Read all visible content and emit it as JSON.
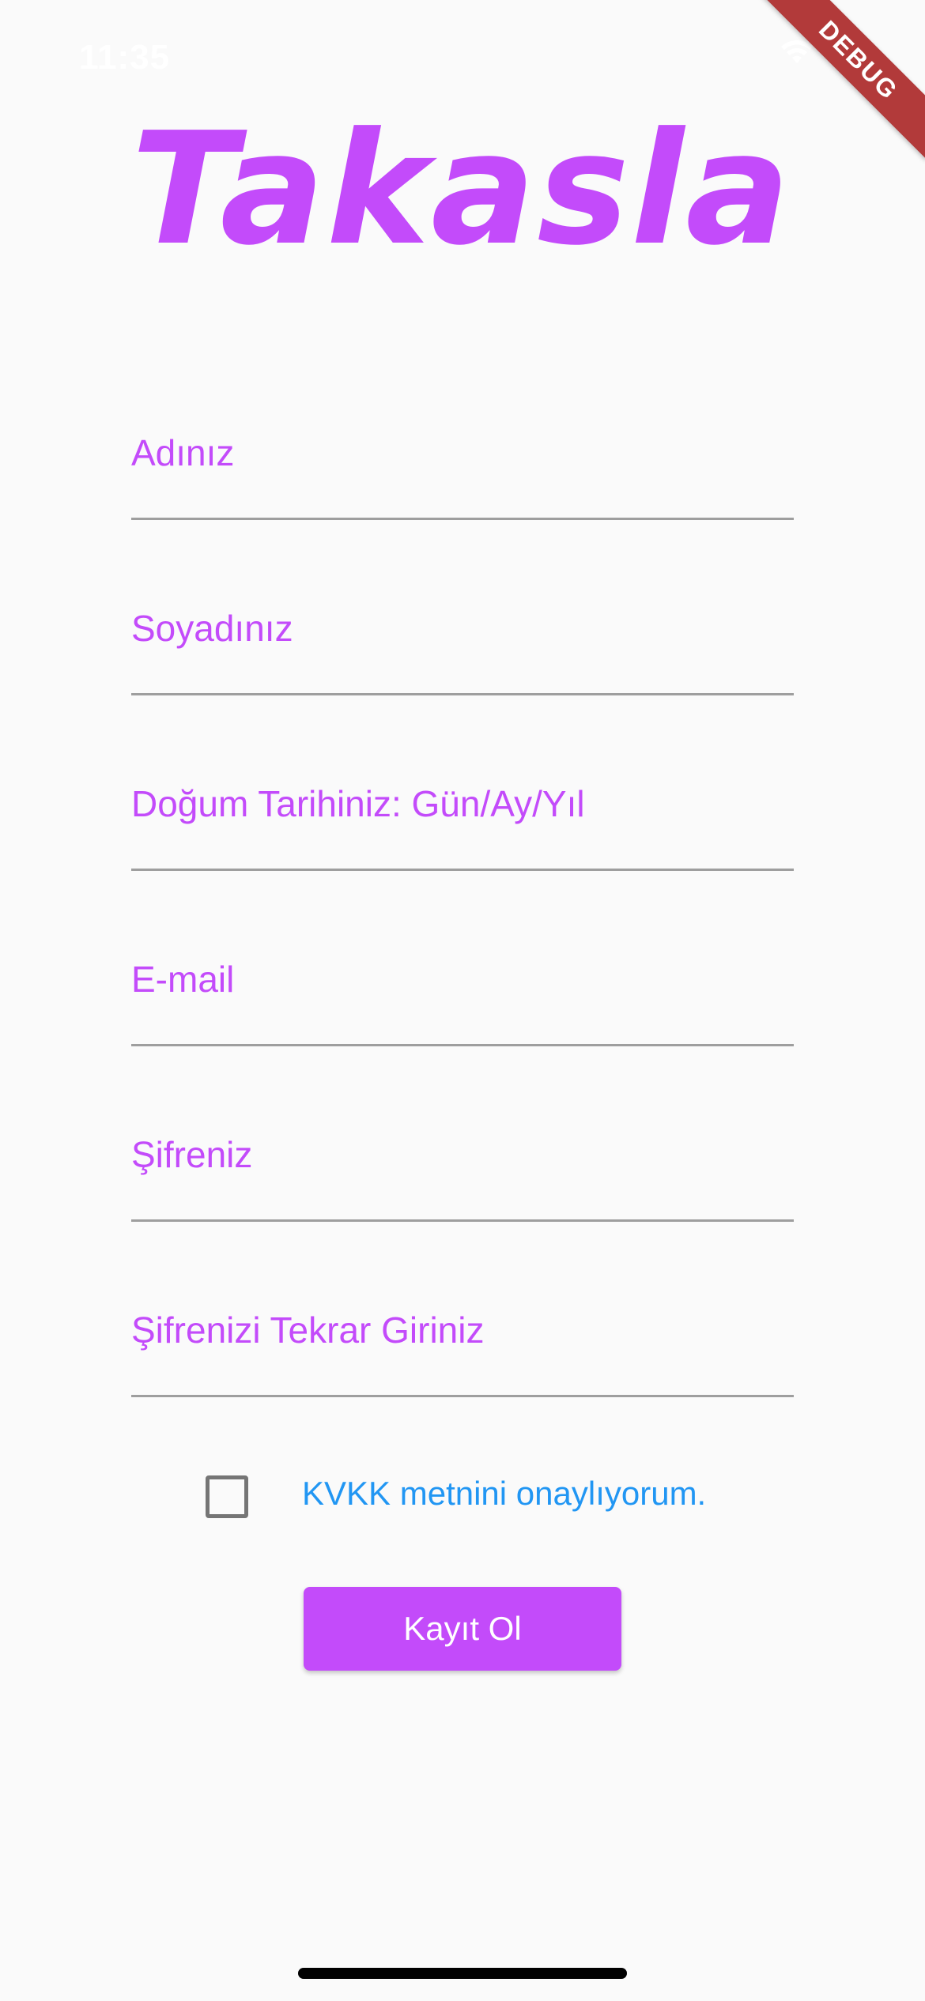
{
  "status_bar": {
    "time": "11:35"
  },
  "debug_banner": {
    "label": "DEBUG"
  },
  "app": {
    "logo": "Takasla",
    "accent_color": "#C34BFA",
    "link_color": "#2196F3"
  },
  "form": {
    "fields": [
      {
        "label": "Adınız",
        "value": ""
      },
      {
        "label": "Soyadınız",
        "value": ""
      },
      {
        "label": "Doğum Tarihiniz:  Gün/Ay/Yıl",
        "value": ""
      },
      {
        "label": "E-mail",
        "value": ""
      },
      {
        "label": "Şifreniz",
        "value": ""
      },
      {
        "label": "Şifrenizi Tekrar Giriniz",
        "value": ""
      }
    ],
    "kvkk_checkbox": {
      "label": "KVKK metnini onaylıyorum.",
      "checked": false
    },
    "submit_label": "Kayıt Ol"
  },
  "icons": {
    "wifi": "wifi-icon",
    "battery": "battery-icon"
  }
}
